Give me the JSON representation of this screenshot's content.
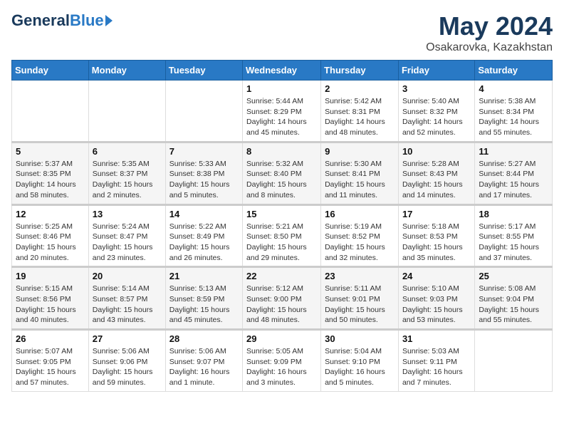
{
  "logo": {
    "general": "General",
    "blue": "Blue"
  },
  "title": "May 2024",
  "subtitle": "Osakarovka, Kazakhstan",
  "headers": [
    "Sunday",
    "Monday",
    "Tuesday",
    "Wednesday",
    "Thursday",
    "Friday",
    "Saturday"
  ],
  "weeks": [
    {
      "days": [
        {
          "num": "",
          "info": ""
        },
        {
          "num": "",
          "info": ""
        },
        {
          "num": "",
          "info": ""
        },
        {
          "num": "1",
          "info": "Sunrise: 5:44 AM\nSunset: 8:29 PM\nDaylight: 14 hours\nand 45 minutes."
        },
        {
          "num": "2",
          "info": "Sunrise: 5:42 AM\nSunset: 8:31 PM\nDaylight: 14 hours\nand 48 minutes."
        },
        {
          "num": "3",
          "info": "Sunrise: 5:40 AM\nSunset: 8:32 PM\nDaylight: 14 hours\nand 52 minutes."
        },
        {
          "num": "4",
          "info": "Sunrise: 5:38 AM\nSunset: 8:34 PM\nDaylight: 14 hours\nand 55 minutes."
        }
      ]
    },
    {
      "days": [
        {
          "num": "5",
          "info": "Sunrise: 5:37 AM\nSunset: 8:35 PM\nDaylight: 14 hours\nand 58 minutes."
        },
        {
          "num": "6",
          "info": "Sunrise: 5:35 AM\nSunset: 8:37 PM\nDaylight: 15 hours\nand 2 minutes."
        },
        {
          "num": "7",
          "info": "Sunrise: 5:33 AM\nSunset: 8:38 PM\nDaylight: 15 hours\nand 5 minutes."
        },
        {
          "num": "8",
          "info": "Sunrise: 5:32 AM\nSunset: 8:40 PM\nDaylight: 15 hours\nand 8 minutes."
        },
        {
          "num": "9",
          "info": "Sunrise: 5:30 AM\nSunset: 8:41 PM\nDaylight: 15 hours\nand 11 minutes."
        },
        {
          "num": "10",
          "info": "Sunrise: 5:28 AM\nSunset: 8:43 PM\nDaylight: 15 hours\nand 14 minutes."
        },
        {
          "num": "11",
          "info": "Sunrise: 5:27 AM\nSunset: 8:44 PM\nDaylight: 15 hours\nand 17 minutes."
        }
      ]
    },
    {
      "days": [
        {
          "num": "12",
          "info": "Sunrise: 5:25 AM\nSunset: 8:46 PM\nDaylight: 15 hours\nand 20 minutes."
        },
        {
          "num": "13",
          "info": "Sunrise: 5:24 AM\nSunset: 8:47 PM\nDaylight: 15 hours\nand 23 minutes."
        },
        {
          "num": "14",
          "info": "Sunrise: 5:22 AM\nSunset: 8:49 PM\nDaylight: 15 hours\nand 26 minutes."
        },
        {
          "num": "15",
          "info": "Sunrise: 5:21 AM\nSunset: 8:50 PM\nDaylight: 15 hours\nand 29 minutes."
        },
        {
          "num": "16",
          "info": "Sunrise: 5:19 AM\nSunset: 8:52 PM\nDaylight: 15 hours\nand 32 minutes."
        },
        {
          "num": "17",
          "info": "Sunrise: 5:18 AM\nSunset: 8:53 PM\nDaylight: 15 hours\nand 35 minutes."
        },
        {
          "num": "18",
          "info": "Sunrise: 5:17 AM\nSunset: 8:55 PM\nDaylight: 15 hours\nand 37 minutes."
        }
      ]
    },
    {
      "days": [
        {
          "num": "19",
          "info": "Sunrise: 5:15 AM\nSunset: 8:56 PM\nDaylight: 15 hours\nand 40 minutes."
        },
        {
          "num": "20",
          "info": "Sunrise: 5:14 AM\nSunset: 8:57 PM\nDaylight: 15 hours\nand 43 minutes."
        },
        {
          "num": "21",
          "info": "Sunrise: 5:13 AM\nSunset: 8:59 PM\nDaylight: 15 hours\nand 45 minutes."
        },
        {
          "num": "22",
          "info": "Sunrise: 5:12 AM\nSunset: 9:00 PM\nDaylight: 15 hours\nand 48 minutes."
        },
        {
          "num": "23",
          "info": "Sunrise: 5:11 AM\nSunset: 9:01 PM\nDaylight: 15 hours\nand 50 minutes."
        },
        {
          "num": "24",
          "info": "Sunrise: 5:10 AM\nSunset: 9:03 PM\nDaylight: 15 hours\nand 53 minutes."
        },
        {
          "num": "25",
          "info": "Sunrise: 5:08 AM\nSunset: 9:04 PM\nDaylight: 15 hours\nand 55 minutes."
        }
      ]
    },
    {
      "days": [
        {
          "num": "26",
          "info": "Sunrise: 5:07 AM\nSunset: 9:05 PM\nDaylight: 15 hours\nand 57 minutes."
        },
        {
          "num": "27",
          "info": "Sunrise: 5:06 AM\nSunset: 9:06 PM\nDaylight: 15 hours\nand 59 minutes."
        },
        {
          "num": "28",
          "info": "Sunrise: 5:06 AM\nSunset: 9:07 PM\nDaylight: 16 hours\nand 1 minute."
        },
        {
          "num": "29",
          "info": "Sunrise: 5:05 AM\nSunset: 9:09 PM\nDaylight: 16 hours\nand 3 minutes."
        },
        {
          "num": "30",
          "info": "Sunrise: 5:04 AM\nSunset: 9:10 PM\nDaylight: 16 hours\nand 5 minutes."
        },
        {
          "num": "31",
          "info": "Sunrise: 5:03 AM\nSunset: 9:11 PM\nDaylight: 16 hours\nand 7 minutes."
        },
        {
          "num": "",
          "info": ""
        }
      ]
    }
  ]
}
